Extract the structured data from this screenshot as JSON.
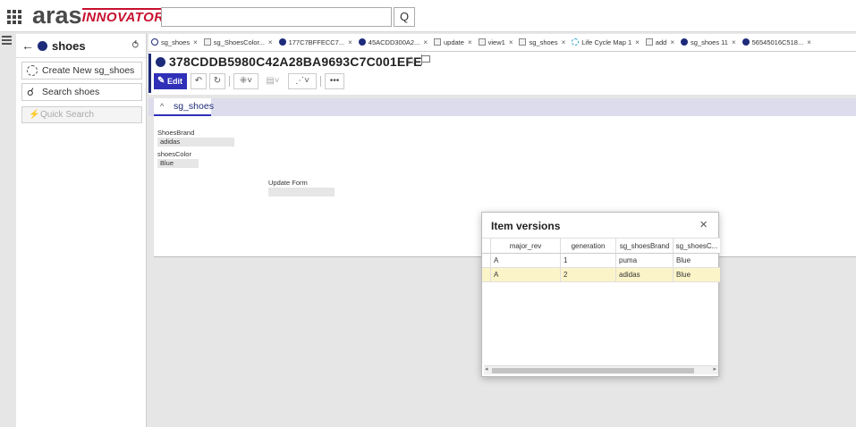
{
  "app": {
    "brand_main": "aras",
    "brand_sub": "INNOVATOR",
    "search_value": "",
    "search_icon": "Q"
  },
  "sidebar": {
    "back_icon": "←",
    "title": "shoes",
    "pin_icon": "⥀",
    "create_label": "Create New sg_shoes",
    "search_label": "Search shoes",
    "quick_search_placeholder": "Quick Search",
    "quick_search_icon": "⚡"
  },
  "tabs": [
    {
      "icon": "outline",
      "label": "sg_shoes"
    },
    {
      "icon": "doc",
      "label": "sg_ShoesColor..."
    },
    {
      "icon": "dot",
      "label": "177C7BFFECC7..."
    },
    {
      "icon": "dot",
      "label": "45ACDD300A2..."
    },
    {
      "icon": "doc",
      "label": "update"
    },
    {
      "icon": "doc",
      "label": "view1"
    },
    {
      "icon": "doc",
      "label": "sg_shoes"
    },
    {
      "icon": "lc",
      "label": "Life Cycle Map 1"
    },
    {
      "icon": "doc",
      "label": "add"
    },
    {
      "icon": "dot",
      "label": "sg_shoes 11"
    },
    {
      "icon": "dot",
      "label": "56545016C518..."
    }
  ],
  "tab_close": "×",
  "item": {
    "title": "378CDDB5980C42A28BA9693C7C001EFE",
    "star": "☆",
    "toolbar": {
      "edit_label": "Edit",
      "edit_icon": "✎",
      "undo_icon": "↶",
      "refresh_icon": "↻",
      "tree_icon": "⁜",
      "copy_icon": "▤",
      "share_icon": "⋰",
      "more_icon": "•••",
      "caret": "˅"
    }
  },
  "form": {
    "tab_label": "sg_shoes",
    "tab_chevron": "^",
    "fields": [
      {
        "label": "ShoesBrand",
        "value": "adidas"
      },
      {
        "label": "shoesColor",
        "value": "Blue"
      },
      {
        "label": "Update Form",
        "value": ""
      }
    ]
  },
  "dialog": {
    "title": "Item versions",
    "close_icon": "×",
    "columns": [
      "",
      "major_rev",
      "generation",
      "sg_shoesBrand",
      "sg_shoesC..."
    ],
    "rows": [
      {
        "major_rev": "A",
        "generation": "1",
        "brand": "puma",
        "color": "Blue",
        "selected": false
      },
      {
        "major_rev": "A",
        "generation": "2",
        "brand": "adidas",
        "color": "Blue",
        "selected": true
      }
    ],
    "scroll_left": "◂",
    "scroll_right": "▸"
  }
}
